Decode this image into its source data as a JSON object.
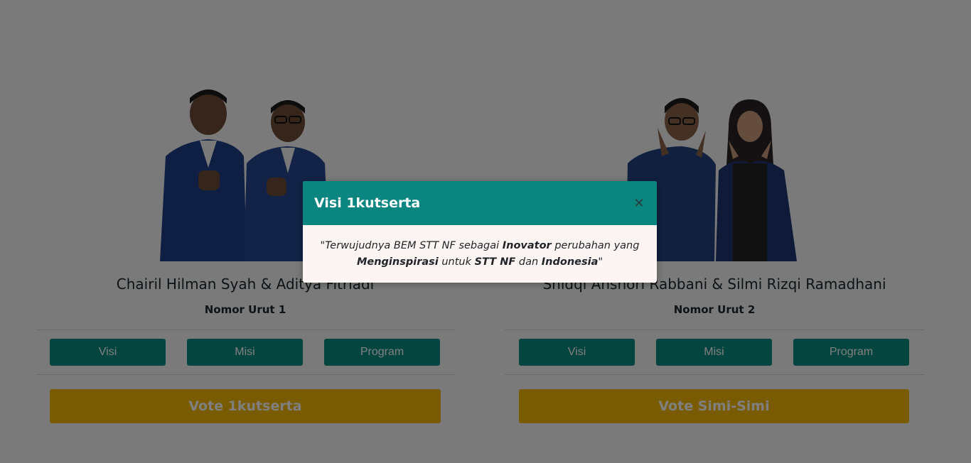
{
  "candidates": [
    {
      "names": "Chairil Hilman Syah & Aditya Fitriadi",
      "nomor": "Nomor Urut 1",
      "buttons": {
        "visi": "Visi",
        "misi": "Misi",
        "program": "Program"
      },
      "vote": "Vote 1kutserta"
    },
    {
      "names": "Shidqi Anshori Rabbani & Silmi Rizqi Ramadhani",
      "nomor": "Nomor Urut 2",
      "buttons": {
        "visi": "Visi",
        "misi": "Misi",
        "program": "Program"
      },
      "vote": "Vote Simi-Simi"
    }
  ],
  "modal": {
    "title": "Visi 1kutserta",
    "close_icon": "close-icon",
    "quote_open": "\"Terwujudnya BEM STT NF sebagai ",
    "bold1": "Inovator",
    "text2": " perubahan yang ",
    "bold2": "Menginspirasi",
    "text3": " untuk ",
    "bold3": "STT NF",
    "text4": " dan ",
    "bold4": "Indonesia",
    "quote_close": "\""
  },
  "colors": {
    "primary_button": "#0a8a7f",
    "vote_button": "#f2b705",
    "modal_header": "#0a8580",
    "modal_body": "#fdf5f3"
  }
}
